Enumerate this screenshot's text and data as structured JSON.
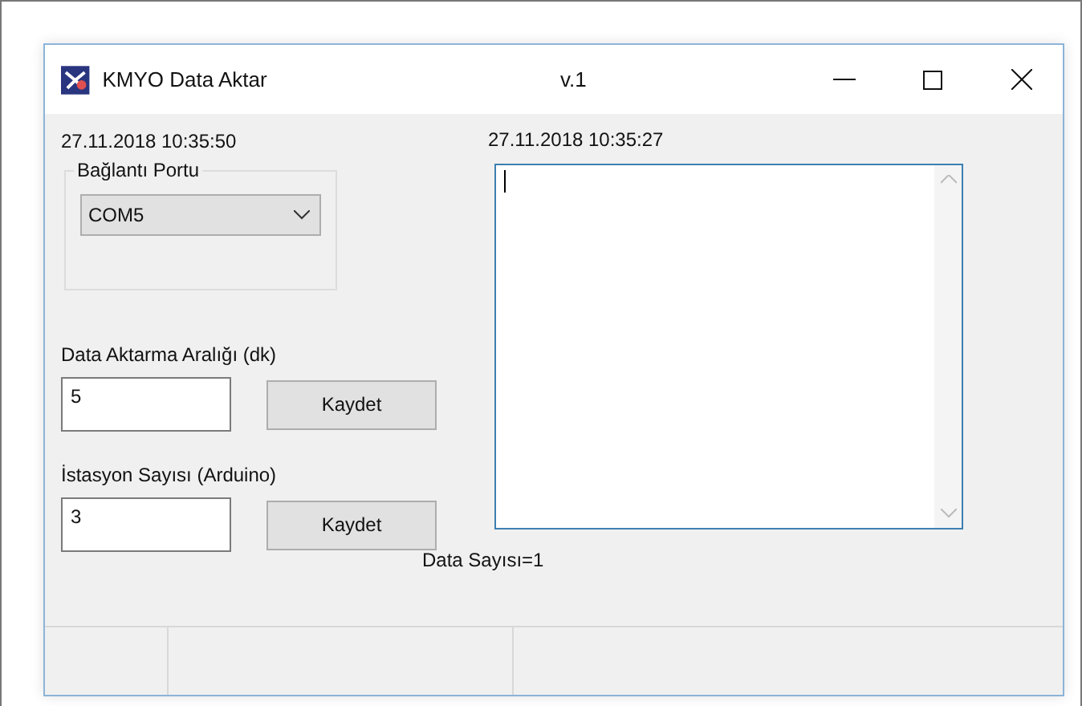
{
  "window": {
    "title": "KMYO Data Aktar",
    "version": "v.1"
  },
  "clock": "27.11.2018 10:35:50",
  "port_group": {
    "title": "Bağlantı Portu",
    "value": "COM5"
  },
  "interval": {
    "label": "Data Aktarma Aralığı (dk)",
    "value": "5",
    "button": "Kaydet"
  },
  "stations": {
    "label": "İstasyon Sayısı (Arduino)",
    "value": "3",
    "button": "Kaydet"
  },
  "data_count": "Data Sayısı=1",
  "log": {
    "timestamp": "27.11.2018 10:35:27"
  }
}
